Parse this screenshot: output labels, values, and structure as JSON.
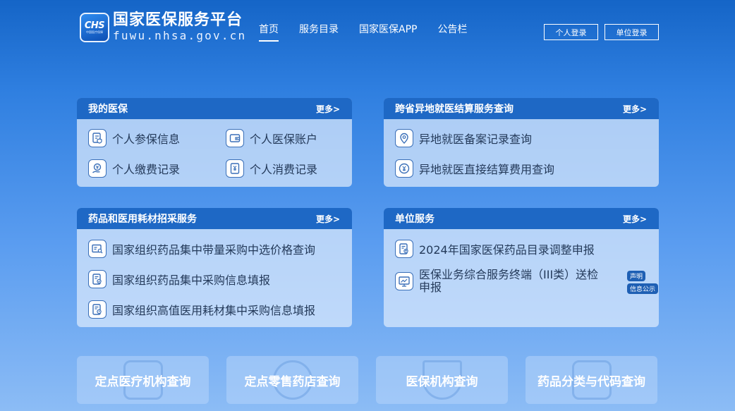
{
  "header": {
    "logo_mark": "CHS",
    "logo_mark_sub": "中国医疗保障",
    "title": "国家医保服务平台",
    "domain": "fuwu.nhsa.gov.cn",
    "nav": [
      "首页",
      "服务目录",
      "国家医保APP",
      "公告栏"
    ],
    "login_personal": "个人登录",
    "login_unit": "单位登录"
  },
  "cards": {
    "mine": {
      "title": "我的医保",
      "more": "更多>",
      "items": [
        "个人参保信息",
        "个人医保账户",
        "个人缴费记录",
        "个人消费记录"
      ]
    },
    "cross": {
      "title": "跨省异地就医结算服务查询",
      "more": "更多>",
      "items": [
        "异地就医备案记录查询",
        "异地就医直接结算费用查询"
      ]
    },
    "drug": {
      "title": "药品和医用耗材招采服务",
      "more": "更多>",
      "items": [
        "国家组织药品集中带量采购中选价格查询",
        "国家组织药品集中采购信息填报",
        "国家组织高值医用耗材集中采购信息填报"
      ]
    },
    "unit": {
      "title": "单位服务",
      "more": "更多>",
      "items": [
        "2024年国家医保药品目录调整申报",
        "医保业务综合服务终端（III类）送检申报"
      ],
      "tags": [
        "声明",
        "信息公示"
      ]
    }
  },
  "tiles": [
    "定点医疗机构查询",
    "定点零售药店查询",
    "医保机构查询",
    "药品分类与代码查询"
  ],
  "colors": {
    "header_blue": "#1565c7",
    "card_head": "#1e68c5",
    "item_text": "#243a5a"
  }
}
